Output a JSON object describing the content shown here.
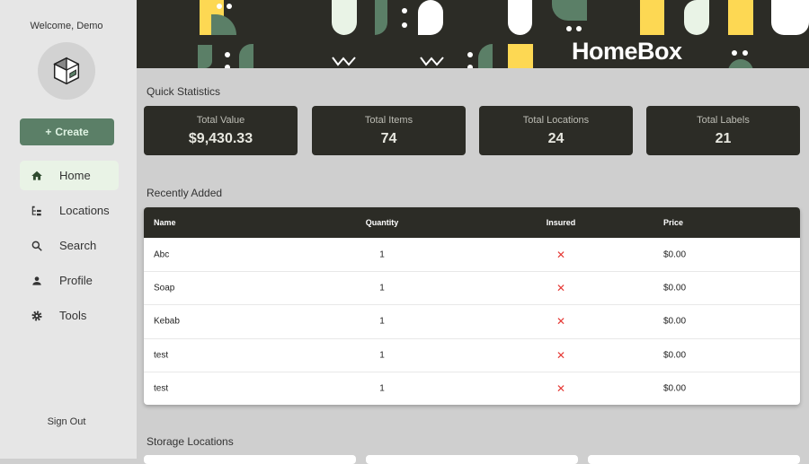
{
  "sidebar": {
    "welcome": "Welcome, Demo",
    "create_label": "Create",
    "create_icon": "+",
    "items": [
      {
        "label": "Home",
        "icon": "home-icon"
      },
      {
        "label": "Locations",
        "icon": "tree-icon"
      },
      {
        "label": "Search",
        "icon": "search-icon"
      },
      {
        "label": "Profile",
        "icon": "person-icon"
      },
      {
        "label": "Tools",
        "icon": "gear-icon"
      }
    ],
    "sign_out": "Sign Out"
  },
  "banner": {
    "logo": "HomeBox"
  },
  "quick_stats": {
    "title": "Quick Statistics",
    "cards": [
      {
        "label": "Total Value",
        "value": "$9,430.33"
      },
      {
        "label": "Total Items",
        "value": "74"
      },
      {
        "label": "Total Locations",
        "value": "24"
      },
      {
        "label": "Total Labels",
        "value": "21"
      }
    ]
  },
  "recent": {
    "title": "Recently Added",
    "headers": [
      "Name",
      "Quantity",
      "Insured",
      "Price"
    ],
    "rows": [
      {
        "name": "Abc",
        "qty": "1",
        "insured": "✕",
        "price": "$0.00"
      },
      {
        "name": "Soap",
        "qty": "1",
        "insured": "✕",
        "price": "$0.00"
      },
      {
        "name": "Kebab",
        "qty": "1",
        "insured": "✕",
        "price": "$0.00"
      },
      {
        "name": "test",
        "qty": "1",
        "insured": "✕",
        "price": "$0.00"
      },
      {
        "name": "test",
        "qty": "1",
        "insured": "✕",
        "price": "$0.00"
      }
    ]
  },
  "storage": {
    "title": "Storage Locations"
  },
  "colors": {
    "primary": "#5b7f67",
    "dark": "#2c2c26",
    "accent": "#fdd853",
    "error": "#e53935"
  }
}
